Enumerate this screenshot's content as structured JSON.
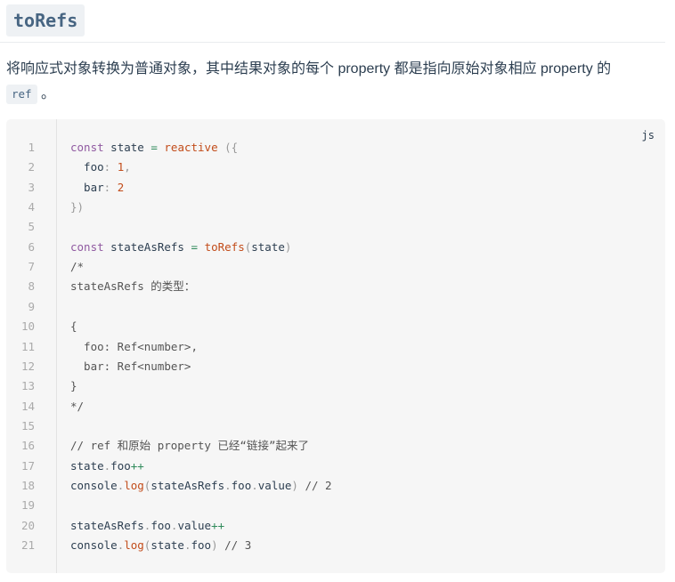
{
  "heading": "toRefs",
  "description": {
    "text": "将响应式对象转换为普通对象，其中结果对象的每个 property 都是指向原始对象相应 property 的",
    "code_term": "ref",
    "suffix": "。"
  },
  "code_block": {
    "language": "js",
    "line_numbers": [
      "1",
      "2",
      "3",
      "4",
      "5",
      "6",
      "7",
      "8",
      "9",
      "10",
      "11",
      "12",
      "13",
      "14",
      "15",
      "16",
      "17",
      "18",
      "19",
      "20",
      "21"
    ],
    "lines": [
      [
        [
          "kw",
          "const"
        ],
        [
          "",
          "state"
        ],
        [
          "op",
          "="
        ],
        [
          "fn",
          "reactive"
        ],
        [
          "punc",
          "({"
        ]
      ],
      [
        [
          "",
          "  foo"
        ],
        [
          "punc",
          ":"
        ],
        [
          "num",
          " 1"
        ],
        [
          "punc",
          ","
        ]
      ],
      [
        [
          "",
          "  bar"
        ],
        [
          "punc",
          ":"
        ],
        [
          "num",
          " 2"
        ]
      ],
      [
        [
          "punc",
          "})"
        ]
      ],
      [],
      [
        [
          "kw",
          "const"
        ],
        [
          "",
          "stateAsRefs"
        ],
        [
          "op",
          "="
        ],
        [
          "fn",
          "toRefs"
        ],
        [
          "punc",
          "("
        ],
        [
          "",
          "state"
        ],
        [
          "punc",
          ")"
        ]
      ],
      [
        [
          "cm",
          "/*"
        ]
      ],
      [
        [
          "cm",
          "stateAsRefs 的类型："
        ]
      ],
      [],
      [
        [
          "cm",
          "{"
        ]
      ],
      [
        [
          "cm",
          "  foo: Ref<number>,"
        ]
      ],
      [
        [
          "cm",
          "  bar: Ref<number>"
        ]
      ],
      [
        [
          "cm",
          "}"
        ]
      ],
      [
        [
          "cm",
          "*/"
        ]
      ],
      [],
      [
        [
          "cm",
          "// ref 和原始 property 已经“链接”起来了"
        ]
      ],
      [
        [
          "",
          "state"
        ],
        [
          "punc",
          "."
        ],
        [
          "",
          "foo"
        ],
        [
          "op",
          "++"
        ]
      ],
      [
        [
          "",
          "console"
        ],
        [
          "punc",
          "."
        ],
        [
          "fn",
          "log"
        ],
        [
          "punc",
          "("
        ],
        [
          "",
          "stateAsRefs"
        ],
        [
          "punc",
          "."
        ],
        [
          "",
          "foo"
        ],
        [
          "punc",
          "."
        ],
        [
          "",
          "value"
        ],
        [
          "punc",
          ")"
        ],
        [
          "cm",
          "// 2"
        ]
      ],
      [],
      [
        [
          "",
          "stateAsRefs"
        ],
        [
          "punc",
          "."
        ],
        [
          "",
          "foo"
        ],
        [
          "punc",
          "."
        ],
        [
          "",
          "value"
        ],
        [
          "op",
          "++"
        ]
      ],
      [
        [
          "",
          "console"
        ],
        [
          "punc",
          "."
        ],
        [
          "fn",
          "log"
        ],
        [
          "punc",
          "("
        ],
        [
          "",
          "state"
        ],
        [
          "punc",
          "."
        ],
        [
          "",
          "foo"
        ],
        [
          "punc",
          ")"
        ],
        [
          "cm",
          "// 3"
        ]
      ]
    ]
  }
}
